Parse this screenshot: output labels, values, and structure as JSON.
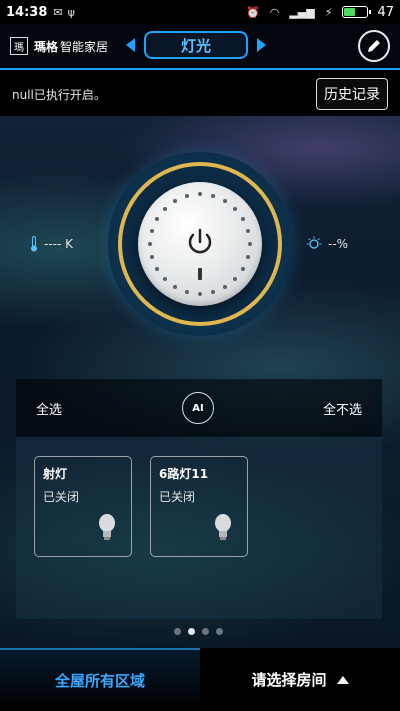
{
  "statusbar": {
    "time": "14:38",
    "battery": "47"
  },
  "header": {
    "logo_char": "瑪",
    "brand_name": "瑪格",
    "brand_sub": "智能家居",
    "current_tab": "灯光"
  },
  "info": {
    "message": "null已执行开启。",
    "history_label": "历史记录"
  },
  "readouts": {
    "color_temp": "---- K",
    "brightness": "--%"
  },
  "panel": {
    "select_all": "全选",
    "select_none": "全不选",
    "ai_label": "AI",
    "devices": [
      {
        "name": "射灯",
        "status": "已关闭"
      },
      {
        "name": "6路灯11",
        "status": "已关闭"
      }
    ]
  },
  "pager": {
    "total": 4,
    "active": 1
  },
  "bottom": {
    "area_label": "全屋所有区域",
    "room_label": "请选择房间"
  }
}
